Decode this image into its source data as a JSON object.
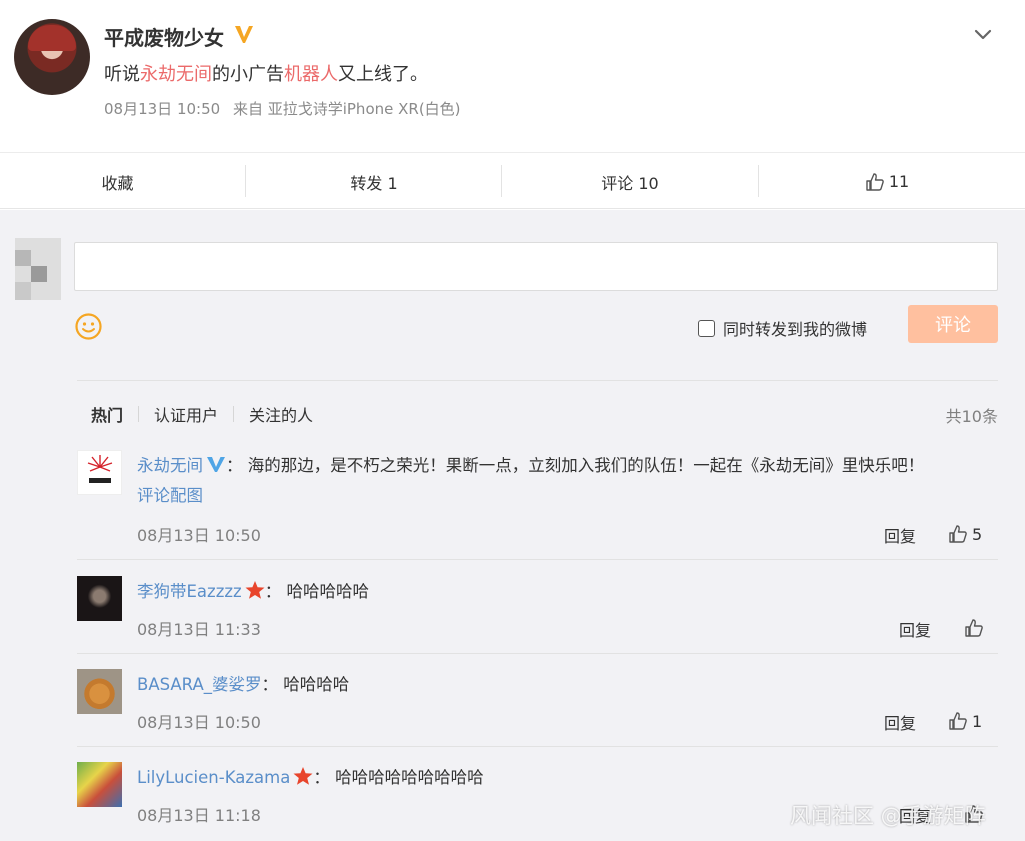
{
  "post": {
    "username": "平成废物少女",
    "text_parts": [
      "听说",
      "永劫无间",
      "的小广告",
      "机器人",
      "又上线了。"
    ],
    "time": "08月13日 10:50",
    "source": "来自 亚拉戈诗学iPhone XR(白色)",
    "badge_color": "#f5a623"
  },
  "actions": {
    "favorite": "收藏",
    "repost": "转发 1",
    "comment": "评论 10",
    "like_count": "11"
  },
  "composer": {
    "input_value": "",
    "repost_label": "同时转发到我的微博",
    "submit_label": "评论",
    "submit_color": "#ffc09f"
  },
  "tabs": [
    "热门",
    "认证用户",
    "关注的人"
  ],
  "total": "共10条",
  "comments": [
    {
      "name": "永劫无间",
      "badge": "verified-v",
      "sep": "：",
      "text": "海的那边，是不朽之荣光！果断一点，立刻加入我们的队伍！一起在《永劫无间》里快乐吧！",
      "link": "评论配图",
      "time": "08月13日 10:50",
      "reply": "回复",
      "likes": "5"
    },
    {
      "name": "李狗带Eazzzz",
      "badge": "star",
      "sep": "：",
      "text": "哈哈哈哈哈",
      "time": "08月13日 11:33",
      "reply": "回复",
      "likes": ""
    },
    {
      "name": "BASARA_婆娑罗",
      "badge": "",
      "sep": "：",
      "text": "哈哈哈哈",
      "time": "08月13日 10:50",
      "reply": "回复",
      "likes": "1"
    },
    {
      "name": "LilyLucien-Kazama",
      "badge": "star",
      "sep": "：",
      "text": "哈哈哈哈哈哈哈哈哈",
      "time": "08月13日 11:18",
      "reply": "回复",
      "likes": ""
    }
  ],
  "watermark": "风闻社区 @手游矩阵",
  "colors": {
    "link": "#5a8ec9",
    "highlight": "#eb6a6a",
    "star": "#e8452c",
    "v": "#4fa5e6"
  }
}
